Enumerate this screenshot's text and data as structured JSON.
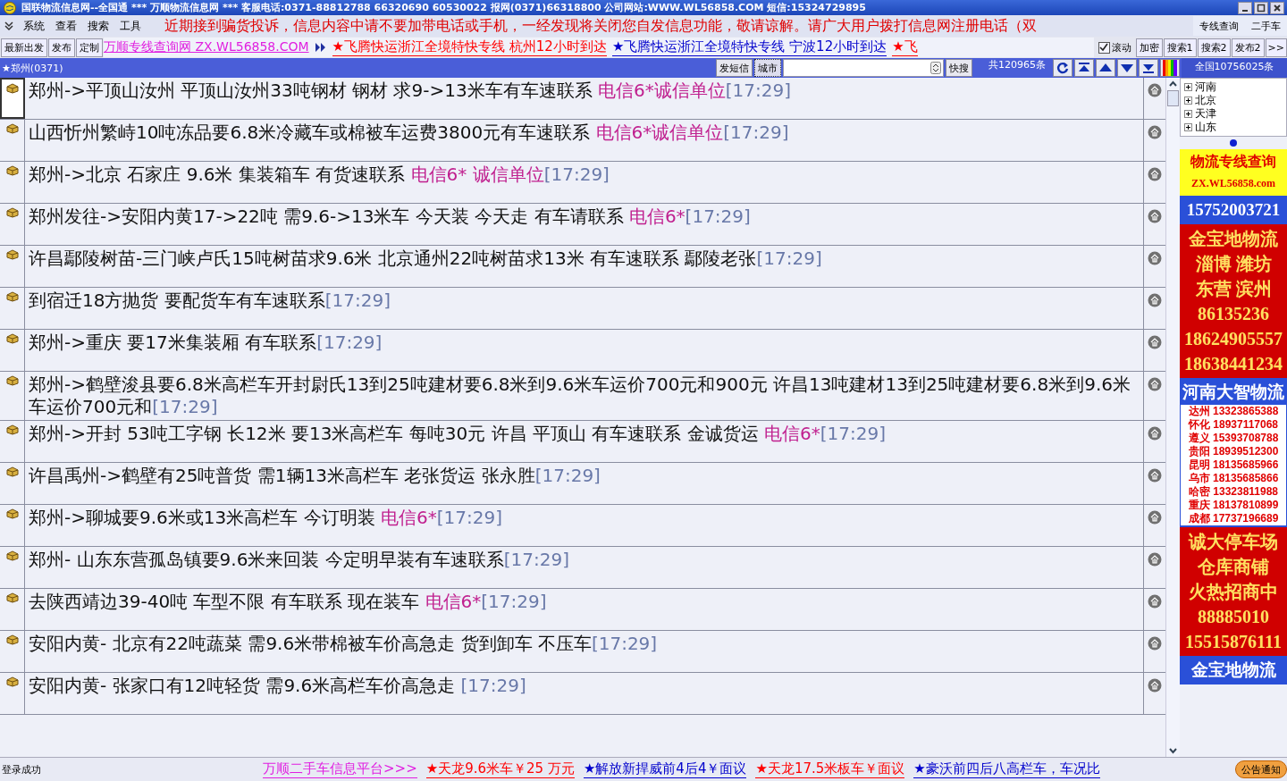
{
  "window": {
    "title": "国联物流信息网--全国通 *** 万顺物流信息网 *** 客服电话:0371-88812788 66320690 60530022 报网(0371)66318800 公司网站:WWW.WL56858.COM 短信:15324729895"
  },
  "menu": [
    "系统",
    "查看",
    "搜索",
    "工具"
  ],
  "notice": "近期接到骗货投诉，信息内容中请不要加带电话或手机，一经发现将关闭您自发信息功能，敬请谅解。请广大用户拨打信息网注册电话（双",
  "top_tabs": [
    {
      "label": "专线查询",
      "selected": false
    },
    {
      "label": "二手车",
      "selected": false
    }
  ],
  "toolbar": {
    "buttons": [
      "最新出发",
      "发布",
      "定制"
    ],
    "link": "万顺专线查询网 ZX.WL56858.COM",
    "ticker": [
      {
        "text": "★飞腾快运浙江全境特快专线 杭州12小时到达",
        "color": "#ff0000"
      },
      {
        "text": "★飞腾快运浙江全境特快专线 宁波12小时到达",
        "color": "#0000cc"
      },
      {
        "text": "★飞",
        "color": "#ff0000"
      }
    ],
    "scroll": {
      "label": "滚动",
      "checked": true
    },
    "right_buttons": [
      "加密",
      "搜索1",
      "搜索2",
      "发布2"
    ],
    "more": ">>"
  },
  "filter_bar": {
    "region": "★郑州(0371)",
    "sms_button": "发短信",
    "city_field": "城市",
    "quick_search": "快搜",
    "count": "共120965条",
    "national_count": "全国10756025条"
  },
  "rows": [
    {
      "text": "郑州->平顶山汝州 平顶山汝州33吨钢材 钢材 求9->13米车有车速联系 ",
      "contact": "电信6*诚信单位",
      "time": "[17:29]",
      "selected": true
    },
    {
      "text": "山西忻州繁峙10吨冻品要6.8米冷藏车或棉被车运费3800元有车速联系 ",
      "contact": "电信6*诚信单位",
      "time": "[17:29]",
      "selected": false
    },
    {
      "text": "郑州->北京 石家庄 9.6米 集装箱车 有货速联系 ",
      "contact": "电信6* 诚信单位",
      "time": "[17:29]",
      "selected": false
    },
    {
      "text": "郑州发往->安阳内黄17->22吨 需9.6->13米车 今天装 今天走 有车请联系 ",
      "contact": "电信6*",
      "time": "[17:29]",
      "selected": false
    },
    {
      "text": "许昌鄢陵树苗-三门峡卢氏15吨树苗求9.6米 北京通州22吨树苗求13米 有车速联系 鄢陵老张",
      "contact": "",
      "time": "[17:29]",
      "selected": false
    },
    {
      "text": "到宿迁18方抛货 要配货车有车速联系",
      "contact": "",
      "time": "[17:29]",
      "selected": false
    },
    {
      "text": "郑州->重庆 要17米集装厢 有车联系",
      "contact": "",
      "time": "[17:29]",
      "selected": false
    },
    {
      "text": "郑州->鹤壁浚县要6.8米高栏车开封尉氏13到25吨建材要6.8米到9.6米车运价700元和900元 许昌13吨建材13到25吨建材要6.8米到9.6米车运价700元和",
      "contact": "",
      "time": "[17:29]",
      "selected": false
    },
    {
      "text": "郑州->开封 53吨工字钢 长12米 要13米高栏车 每吨30元 许昌 平顶山 有车速联系 金诚货运 ",
      "contact": "电信6*",
      "time": "[17:29]",
      "selected": false
    },
    {
      "text": "许昌禹州->鹤壁有25吨普货 需1辆13米高栏车 老张货运 张永胜",
      "contact": "",
      "time": "[17:29]",
      "selected": false
    },
    {
      "text": "郑州->聊城要9.6米或13米高栏车 今订明装 ",
      "contact": "电信6*",
      "time": "[17:29]",
      "selected": false
    },
    {
      "text": "郑州- 山东东营孤岛镇要9.6米来回装 今定明早装有车速联系",
      "contact": "",
      "time": "[17:29]",
      "selected": false
    },
    {
      "text": "去陕西靖边39-40吨 车型不限 有车联系 现在装车 ",
      "contact": "电信6*",
      "time": "[17:29]",
      "selected": false
    },
    {
      "text": "安阳内黄- 北京有22吨蔬菜 需9.6米带棉被车价高急走 货到卸车 不压车",
      "contact": "",
      "time": "[17:29]",
      "selected": false
    },
    {
      "text": "安阳内黄- 张家口有12吨轻货 需9.6米高栏车价高急走 ",
      "contact": "",
      "time": "[17:29]",
      "selected": false
    }
  ],
  "regions": [
    {
      "label": "河南",
      "expanded": false
    },
    {
      "label": "北京",
      "expanded": false
    },
    {
      "label": "天津",
      "expanded": false
    },
    {
      "label": "山东",
      "expanded": false
    }
  ],
  "ads": [
    {
      "kind": "yellow",
      "lines": [
        "物流专线查询",
        "ZX.WL56858.com"
      ]
    },
    {
      "kind": "blue",
      "lines": [
        "15752003721"
      ]
    },
    {
      "kind": "red",
      "lines": [
        "金宝地物流",
        "淄博 潍坊",
        "东营 滨州",
        "86135236",
        "18624905557",
        "18638441234"
      ]
    },
    {
      "kind": "directory",
      "lines": [
        "河南大智物流"
      ],
      "entries": [
        {
          "city": "达州",
          "phone": "13323865388"
        },
        {
          "city": "怀化",
          "phone": "18937117068"
        },
        {
          "city": "遵义",
          "phone": "15393708788"
        },
        {
          "city": "贵阳",
          "phone": "18939512300"
        },
        {
          "city": "昆明",
          "phone": "18135685966"
        },
        {
          "city": "乌市",
          "phone": "18135685866"
        },
        {
          "city": "哈密",
          "phone": "13323811988"
        },
        {
          "city": "重庆",
          "phone": "18137810899"
        },
        {
          "city": "成都",
          "phone": "17737196689"
        }
      ]
    },
    {
      "kind": "red",
      "lines": [
        "诚大停车场",
        "仓库商铺",
        "火热招商中",
        "88885010",
        "15515876111"
      ]
    },
    {
      "kind": "blue",
      "lines": [
        "金宝地物流"
      ]
    }
  ],
  "status_bar": {
    "text": "登录成功",
    "ticker": [
      {
        "text": "万顺二手车信息平台>>>",
        "color": "#e020e0"
      },
      {
        "text": "★天龙9.6米车￥25 万元",
        "color": "#ff0000"
      },
      {
        "text": "★解放新捍威前4后4￥面议",
        "color": "#0000cc"
      },
      {
        "text": "★天龙17.5米板车￥面议",
        "color": "#ff0000"
      },
      {
        "text": "★豪沃前四后八高栏车，车况比",
        "color": "#0000cc"
      }
    ],
    "notice_button": "公告通知"
  }
}
